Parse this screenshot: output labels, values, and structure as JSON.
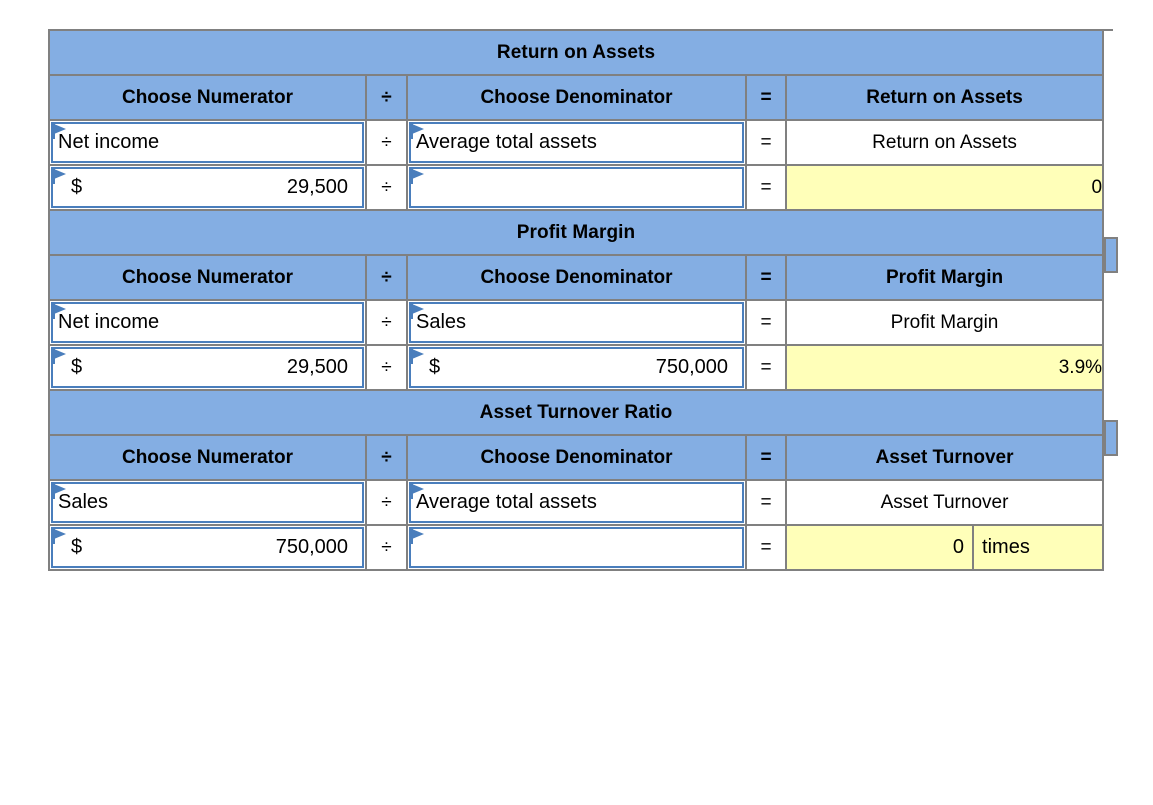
{
  "columns": {
    "numerator": "Choose Numerator",
    "divide_op": "÷",
    "denominator": "Choose Denominator",
    "equals_op": "=",
    "result_header_roa": "Return on Assets",
    "result_header_pm": "Profit Margin",
    "result_header_at": "Asset Turnover"
  },
  "sections": [
    {
      "title": "Return on Assets",
      "numerator_label": "Net income",
      "denominator_label": "Average total assets",
      "result_label": "Return on Assets",
      "numerator_currency": "$",
      "numerator_value": "29,500",
      "denominator_currency": "",
      "denominator_value": "",
      "result_value": "0",
      "result_unit": ""
    },
    {
      "title": "Profit Margin",
      "numerator_label": "Net income",
      "denominator_label": "Sales",
      "result_label": "Profit Margin",
      "numerator_currency": "$",
      "numerator_value": "29,500",
      "denominator_currency": "$",
      "denominator_value": "750,000",
      "result_value": "3.9%",
      "result_unit": ""
    },
    {
      "title": "Asset Turnover Ratio",
      "numerator_label": "Sales",
      "denominator_label": "Average total assets",
      "result_label": "Asset Turnover",
      "numerator_currency": "$",
      "numerator_value": "750,000",
      "denominator_currency": "",
      "denominator_value": "",
      "result_value": "0",
      "result_unit": "times"
    }
  ],
  "colors": {
    "header_blue": "#84AEE3",
    "result_yellow": "#FFFFB9",
    "input_border_blue": "#4A7EBC",
    "grid_gray": "#808080"
  }
}
